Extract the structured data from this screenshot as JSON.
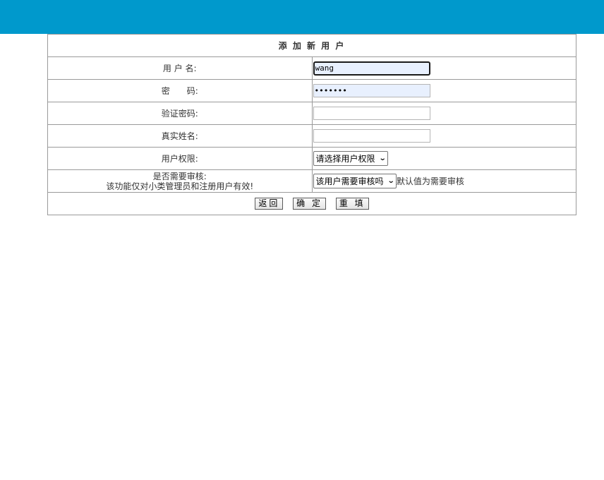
{
  "header": {
    "bar_color": "#0099cc"
  },
  "form": {
    "title": "添 加 新 用 户",
    "username": {
      "label": "用 户 名:",
      "value": "wang"
    },
    "password": {
      "label": "密　　码:",
      "value": "•••••••"
    },
    "confirm_password": {
      "label": "验证密码:",
      "value": ""
    },
    "real_name": {
      "label": "真实姓名:",
      "value": ""
    },
    "permission": {
      "label": "用户权限:",
      "selected": "请选择用户权限"
    },
    "review": {
      "label_line1": "是否需要审核:",
      "label_line2": "该功能仅对小类管理员和注册用户有效!",
      "selected": "该用户需要审核吗",
      "note": "默认值为需要审核"
    },
    "buttons": {
      "back": "返回",
      "confirm": "确 定",
      "reset": "重 填"
    }
  }
}
